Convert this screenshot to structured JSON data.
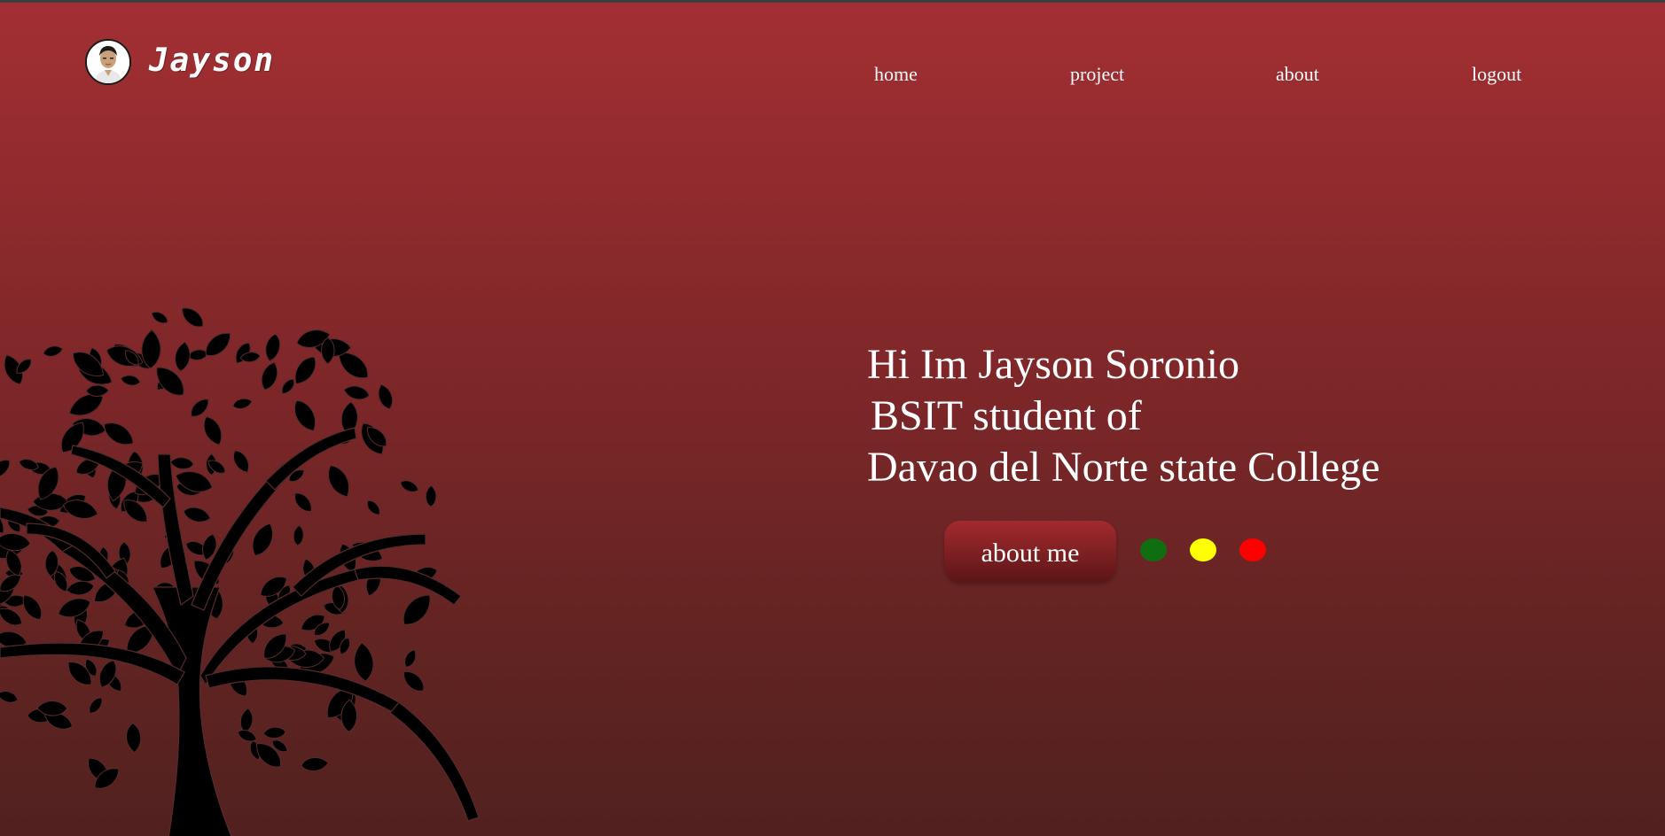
{
  "header": {
    "brand": "Jayson",
    "avatar_alt": "profile photo"
  },
  "nav": {
    "items": [
      {
        "label": "home"
      },
      {
        "label": "project"
      },
      {
        "label": "about"
      },
      {
        "label": "logout"
      }
    ]
  },
  "hero": {
    "lines": [
      "Hi Im Jayson Soronio",
      "BSIT student of",
      "Davao del Norte state College"
    ],
    "button_label": "about me"
  },
  "dots": [
    {
      "name": "green",
      "color": "#0f6e12"
    },
    {
      "name": "yellow",
      "color": "#ffff00"
    },
    {
      "name": "red",
      "color": "#ff0000"
    }
  ],
  "colors": {
    "background_top": "#a32f33",
    "background_bottom": "#51211f",
    "tree": "#000000"
  },
  "icons": {
    "avatar": "avatar-photo",
    "tree": "tree-illustration"
  }
}
